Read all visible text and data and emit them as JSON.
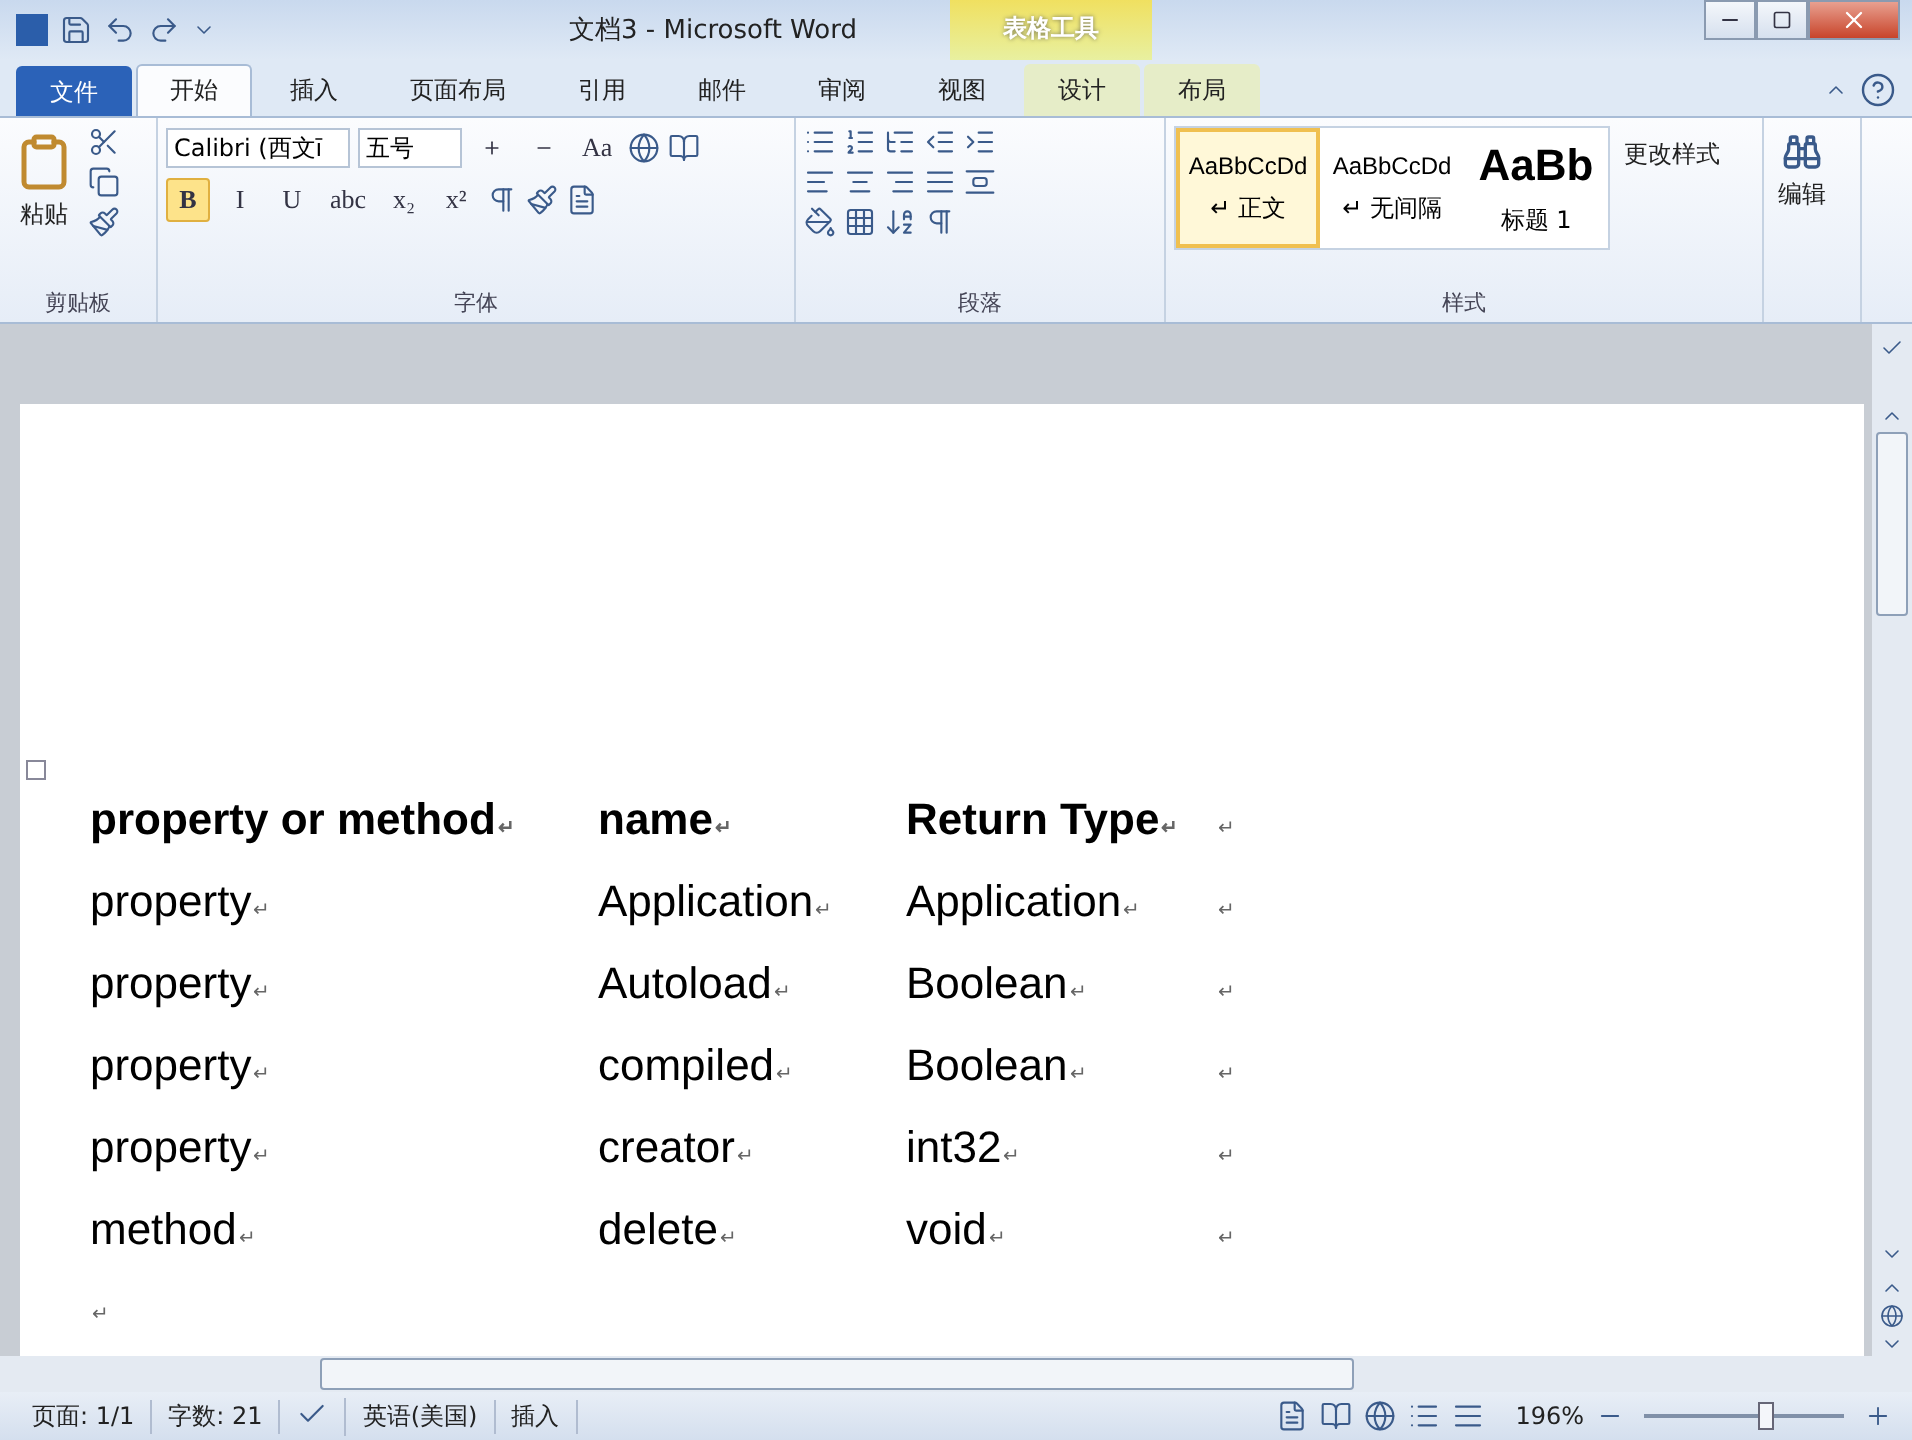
{
  "window": {
    "title": "文档3 - Microsoft Word",
    "context_tab_group": "表格工具"
  },
  "tabs": [
    {
      "label": "文件",
      "kind": "file",
      "selected": false
    },
    {
      "label": "开始",
      "kind": "tab",
      "selected": true
    },
    {
      "label": "插入",
      "kind": "tab",
      "selected": false
    },
    {
      "label": "页面布局",
      "kind": "tab",
      "selected": false
    },
    {
      "label": "引用",
      "kind": "tab",
      "selected": false
    },
    {
      "label": "邮件",
      "kind": "tab",
      "selected": false
    },
    {
      "label": "审阅",
      "kind": "tab",
      "selected": false
    },
    {
      "label": "视图",
      "kind": "tab",
      "selected": false
    },
    {
      "label": "设计",
      "kind": "context",
      "selected": false
    },
    {
      "label": "布局",
      "kind": "context",
      "selected": false
    }
  ],
  "ribbon": {
    "clipboard": {
      "paste": "粘贴",
      "label": "剪贴板"
    },
    "font": {
      "name": "Calibri (西文ī",
      "size": "五号",
      "case_button": "Aa",
      "format_buttons": [
        {
          "label": "B",
          "selected": true
        },
        {
          "label": "I",
          "selected": false
        },
        {
          "label": "U",
          "selected": false
        },
        {
          "label": "abc",
          "selected": false
        },
        {
          "label": "x₂",
          "selected": false
        },
        {
          "label": "x²",
          "selected": false
        }
      ],
      "label": "字体"
    },
    "paragraph": {
      "label": "段落"
    },
    "styles": {
      "items": [
        {
          "preview": "AaBbCcDd",
          "name": "↵ 正文",
          "kind": "normal",
          "selected": true
        },
        {
          "preview": "AaBbCcDd",
          "name": "↵ 无间隔",
          "kind": "normal",
          "selected": false
        },
        {
          "preview": "AaBb",
          "name": "标题 1",
          "kind": "heading",
          "selected": false
        }
      ],
      "change": "更改样式",
      "label": "样式"
    },
    "editing": {
      "label": "编辑"
    }
  },
  "document": {
    "mark": "↵",
    "table": {
      "rows": [
        {
          "header": true,
          "cells": [
            "property or method",
            "name",
            "Return Type"
          ]
        },
        {
          "header": false,
          "cells": [
            "property",
            "Application",
            "Application"
          ]
        },
        {
          "header": false,
          "cells": [
            "property",
            "Autoload",
            "Boolean"
          ]
        },
        {
          "header": false,
          "cells": [
            "property",
            "compiled",
            "Boolean"
          ]
        },
        {
          "header": false,
          "cells": [
            "property",
            "creator",
            "int32"
          ]
        },
        {
          "header": false,
          "cells": [
            "method",
            "delete",
            "void"
          ]
        }
      ]
    }
  },
  "status_bar": {
    "page": "页面: 1/1",
    "words": "字数: 21",
    "language": "英语(美国)",
    "mode": "插入",
    "zoom": "196%",
    "zoom_slider": {
      "level": 0.62
    }
  }
}
